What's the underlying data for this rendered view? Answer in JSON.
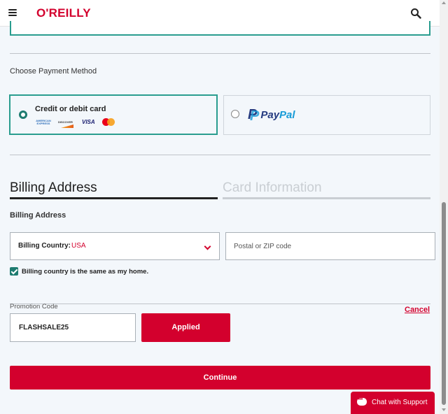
{
  "header": {
    "logo": "O'REILLY",
    "menu_icon": "hamburger-menu-icon",
    "search_icon": "search-icon"
  },
  "payment": {
    "heading": "Choose Payment Method",
    "options": [
      {
        "label": "Credit or debit card",
        "selected": true,
        "logos": [
          "AMERICAN EXPRESS",
          "DISCOVER",
          "VISA",
          "mastercard"
        ]
      },
      {
        "label": "PayPal",
        "selected": false,
        "brand_parts": [
          "Pay",
          "Pal"
        ]
      }
    ]
  },
  "tabs": [
    {
      "label": "Billing Address",
      "active": true
    },
    {
      "label": "Card Information",
      "active": false
    }
  ],
  "billing": {
    "heading": "Billing Address",
    "country_label": "Billing Country:",
    "country_value": "USA",
    "zip_placeholder": "Postal or ZIP code",
    "same_as_home_label": "Billing country is the same as my home.",
    "same_as_home_checked": true
  },
  "promo": {
    "label": "Promotion Code",
    "code": "FLASHSALE25",
    "applied_label": "Applied",
    "cancel_label": "Cancel"
  },
  "actions": {
    "continue_label": "Continue"
  },
  "chat": {
    "label": "Chat with Support"
  },
  "colors": {
    "brand": "#d3002d",
    "accent": "#2a9d8f",
    "checkbox": "#1e7b70",
    "background": "#f3f7fb"
  }
}
